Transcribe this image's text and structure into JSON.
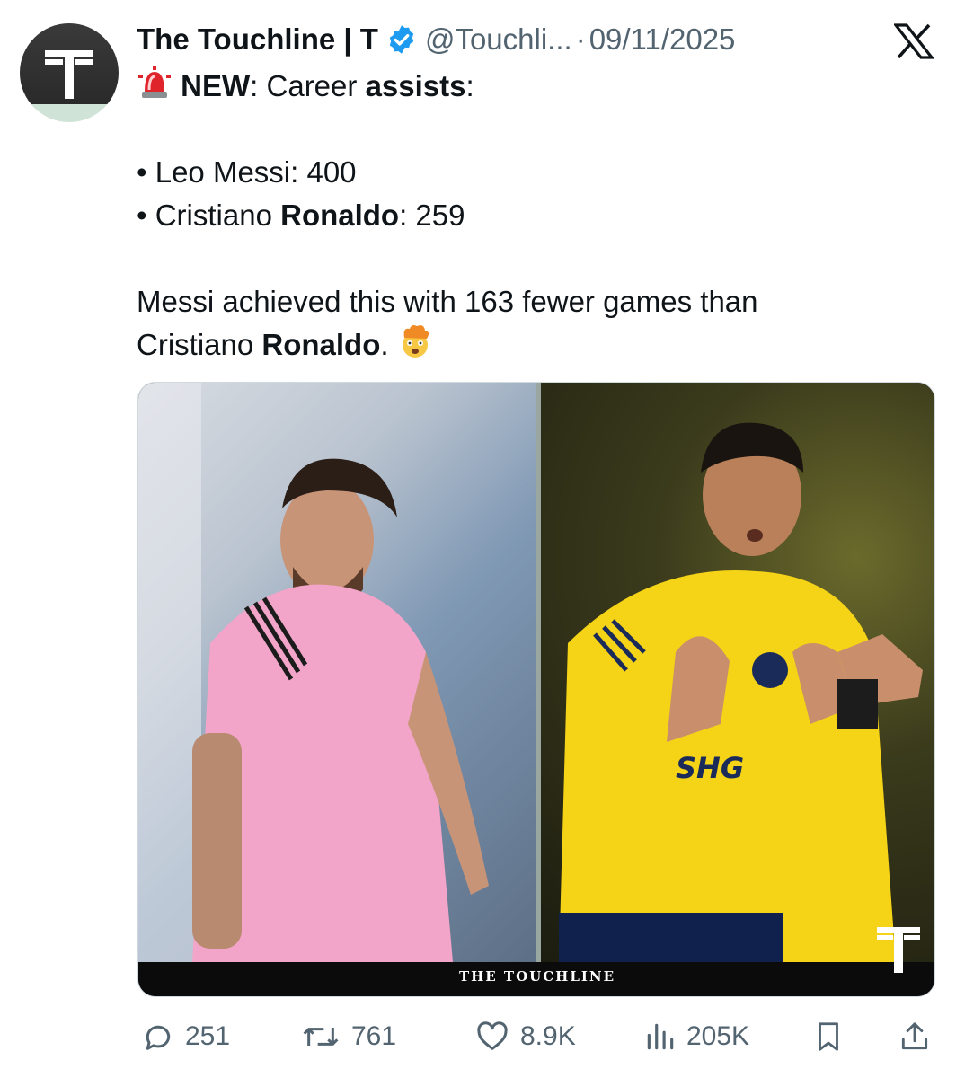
{
  "author": {
    "display_name": "The Touchline | T",
    "handle": "@Touchli...",
    "date": "09/11/2025",
    "avatar_letter": "T",
    "avatar_icon": "touchline-logo",
    "verified_icon": "verified-badge-icon"
  },
  "tweet": {
    "line1": {
      "emoji": "rotating-light",
      "new_label": "NEW",
      "colon": ":",
      "career": " Career ",
      "assists": "assists",
      "end": ":"
    },
    "bullet1": "• Leo Messi: 400",
    "bullet2": {
      "prefix": "• Cristiano ",
      "bold": "Ronaldo",
      "suffix": ": 259"
    },
    "para2_line1": "Messi achieved this with 163 fewer games than",
    "para2_line2": {
      "prefix": "Cristiano ",
      "bold": "Ronaldo",
      "suffix": ".",
      "emoji": "exploding-head"
    }
  },
  "media": {
    "caption": "THE TOUCHLINE",
    "left_photo": "messi-photo",
    "right_photo": "ronaldo-photo",
    "watermark": "touchline-t-logo"
  },
  "actions": {
    "replies": "251",
    "reposts": "761",
    "likes": "8.9K",
    "views": "205K"
  },
  "colors": {
    "text": "#0f1419",
    "secondary": "#536471",
    "verified": "#1d9bf0"
  },
  "icons": [
    "reply-icon",
    "repost-icon",
    "like-icon",
    "views-icon",
    "bookmark-icon",
    "share-icon",
    "x-logo-icon"
  ]
}
